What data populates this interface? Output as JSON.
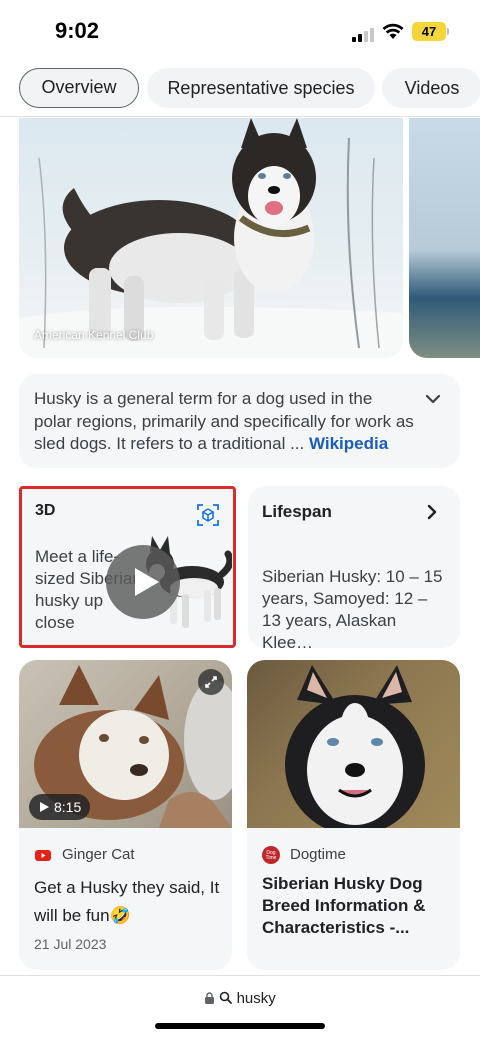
{
  "status_bar": {
    "time": "9:02",
    "battery": "47",
    "battery_color": "#f4d63a"
  },
  "tabs": [
    {
      "label": "Overview",
      "active": true
    },
    {
      "label": "Representative species",
      "active": false
    },
    {
      "label": "Videos",
      "active": false
    }
  ],
  "hero": {
    "credit": "American Kennel Club"
  },
  "description": {
    "text": "Husky is a general term for a dog used in the polar regions, primarily and specifically for work as sled dogs. It refers to a traditional",
    "ellipsis": " ... ",
    "source": "Wikipedia",
    "icon": "chevron-down-icon"
  },
  "card_3d": {
    "title": "3D",
    "text": "Meet a life-sized Siberian husky up close",
    "highlight_color": "#d92b2b",
    "icons": [
      "ar-cube-icon",
      "play-icon"
    ]
  },
  "lifespan": {
    "title": "Lifespan",
    "text": "Siberian Husky: 10 – 15 years, Samoyed: 12 – 13 years, Alaskan Klee…",
    "icon": "chevron-right-icon"
  },
  "articles": [
    {
      "duration": "8:15",
      "source": "Ginger Cat",
      "source_icon": "youtube-icon",
      "title": "Get a Husky they said, It will be fun🤣",
      "date": "21 Jul 2023"
    },
    {
      "source": "Dogtime",
      "source_icon": "dogtime-logo",
      "title": "Siberian Husky Dog Breed Information & Characteristics -..."
    }
  ],
  "bottom_bar": {
    "url": "husky",
    "icons": [
      "lock-icon",
      "search-icon"
    ]
  }
}
